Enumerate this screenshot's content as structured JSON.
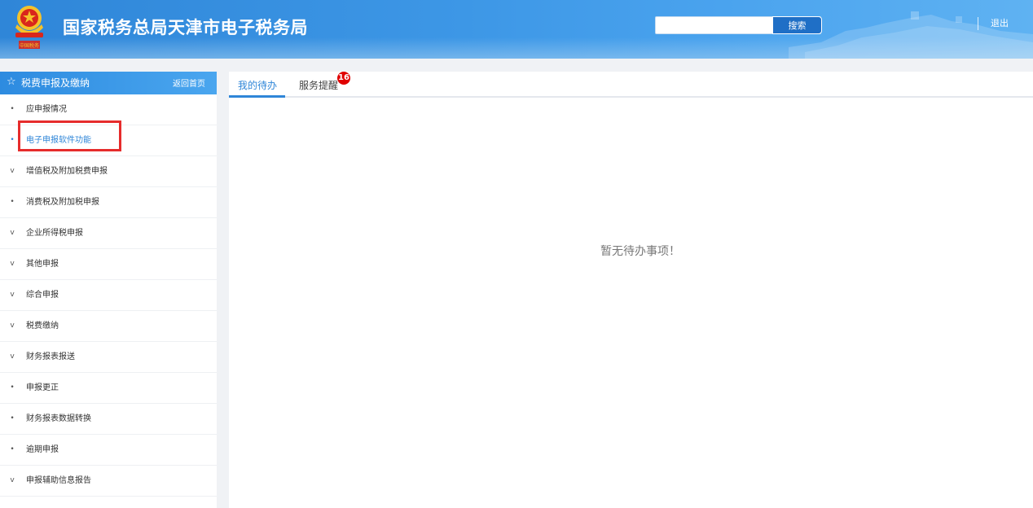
{
  "header": {
    "site_title": "国家税务总局天津市电子税务局",
    "emblem_text": "中国税务",
    "search": {
      "value": "",
      "placeholder": "",
      "button_label": "搜索"
    },
    "logout_label": "退出",
    "colors": {
      "header_bg": "#3d97e6",
      "search_button": "#1f6fc6"
    }
  },
  "sidebar": {
    "star_icon": "☆",
    "title": "税费申报及缴纳",
    "back_label": "返回首页",
    "items": [
      {
        "label": "应申报情况",
        "marker": "•",
        "kind": "bullet",
        "active": false
      },
      {
        "label": "电子申报软件功能",
        "marker": "•",
        "kind": "bullet",
        "active": true
      },
      {
        "label": "增值税及附加税费申报",
        "marker": "v",
        "kind": "expand",
        "active": false
      },
      {
        "label": "消费税及附加税申报",
        "marker": "•",
        "kind": "bullet",
        "active": false
      },
      {
        "label": "企业所得税申报",
        "marker": "v",
        "kind": "expand",
        "active": false
      },
      {
        "label": "其他申报",
        "marker": "v",
        "kind": "expand",
        "active": false
      },
      {
        "label": "综合申报",
        "marker": "v",
        "kind": "expand",
        "active": false
      },
      {
        "label": "税费缴纳",
        "marker": "v",
        "kind": "expand",
        "active": false
      },
      {
        "label": "财务报表报送",
        "marker": "v",
        "kind": "expand",
        "active": false
      },
      {
        "label": "申报更正",
        "marker": "•",
        "kind": "bullet",
        "active": false
      },
      {
        "label": "财务报表数据转换",
        "marker": "•",
        "kind": "bullet",
        "active": false
      },
      {
        "label": "逾期申报",
        "marker": "•",
        "kind": "bullet",
        "active": false
      },
      {
        "label": "申报辅助信息报告",
        "marker": "v",
        "kind": "expand",
        "active": false
      }
    ],
    "colors": {
      "active": "#2f86d8",
      "highlight_border": "#e62c2c"
    }
  },
  "main": {
    "tabs": [
      {
        "label": "我的待办",
        "active": true
      },
      {
        "label": "服务提醒",
        "active": false,
        "badge": "16"
      }
    ],
    "empty_message": "暂无待办事项！"
  }
}
